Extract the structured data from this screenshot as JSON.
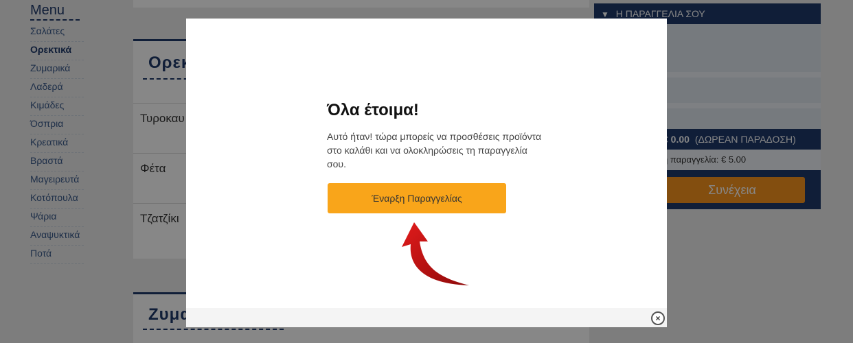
{
  "menu": {
    "title": "Menu",
    "items": [
      {
        "label": "Σαλάτες"
      },
      {
        "label": "Ορεκτικά"
      },
      {
        "label": "Ζυμαρικά"
      },
      {
        "label": "Λαδερά"
      },
      {
        "label": "Κιμάδες"
      },
      {
        "label": "Όσπρια"
      },
      {
        "label": "Κρεατικά"
      },
      {
        "label": "Βραστά"
      },
      {
        "label": "Μαγειρευτά"
      },
      {
        "label": "Κοτόπουλα"
      },
      {
        "label": "Ψάρια"
      },
      {
        "label": "Αναψυκτικά"
      },
      {
        "label": "Ποτά"
      }
    ]
  },
  "content": {
    "section1_title": "Ορεκ",
    "products": [
      {
        "name": "Τυροκαυ"
      },
      {
        "name": "Φέτα"
      },
      {
        "name": "Τζατζίκι"
      }
    ],
    "section2_title": "Ζυμα"
  },
  "order": {
    "header": "Η ΠΑΡΑΓΓΕΛΙΑ ΣΟΥ",
    "total_amount": "€ 0.00",
    "delivery_note": "(ΔΩΡΕΑΝ ΠΑΡΑΔΟΣΗ)",
    "min_order": "η παραγγελία: € 5.00",
    "continue_label": "Συνέχεια"
  },
  "modal": {
    "title": "Όλα έτοιμα!",
    "text": "Αυτό ήταν! τώρα μπορείς να προσθέσεις προϊόντα στο καλάθι και να ολοκληρώσεις τη παραγγελία σου.",
    "start_label": "Έναρξη Παραγγελίας",
    "close_glyph": "×"
  },
  "colors": {
    "brand_navy": "#1f3a6b",
    "accent_orange": "#f9a51a",
    "arrow_red": "#c40f0f"
  },
  "icons": {
    "header_toggle": "triangle-down-icon",
    "close": "close-icon",
    "pointer": "curved-arrow-icon"
  }
}
